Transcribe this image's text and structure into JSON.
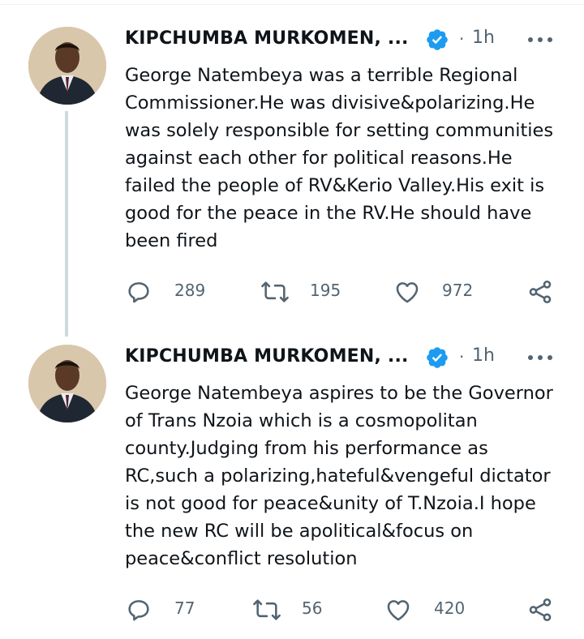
{
  "tweets": [
    {
      "author": "KIPCHUMBA MURKOMEN, ...",
      "time": "1h",
      "separator": "·",
      "text": "George Natembeya was a terrible Regional\nCommissioner.He was divisive&polarizing.He\nwas solely responsible for setting communities\nagainst each other for political reasons.He\nfailed the people of RV&Kerio Valley.His exit is\ngood for the peace in the RV.He should have\nbeen fired",
      "replies": "289",
      "retweets": "195",
      "likes": "972"
    },
    {
      "author": "KIPCHUMBA MURKOMEN, ...",
      "time": "1h",
      "separator": "·",
      "text": "George Natembeya aspires to be the Governor\nof Trans Nzoia which is a cosmopolitan\ncounty.Judging from his performance as\nRC,such a polarizing,hateful&vengeful dictator\nis not good for peace&unity of T.Nzoia.I hope\nthe new RC will be apolitical&focus on\npeace&conflict resolution",
      "replies": "77",
      "retweets": "56",
      "likes": "420"
    }
  ],
  "icons": {
    "verified": "verified-badge-icon",
    "more": "more-dots-icon",
    "reply": "reply-icon",
    "retweet": "retweet-icon",
    "like": "like-icon",
    "share": "share-icon"
  },
  "colors": {
    "verified_blue": "#1d9bf0",
    "secondary_text": "#536471",
    "thread_line": "#cfd9de"
  }
}
